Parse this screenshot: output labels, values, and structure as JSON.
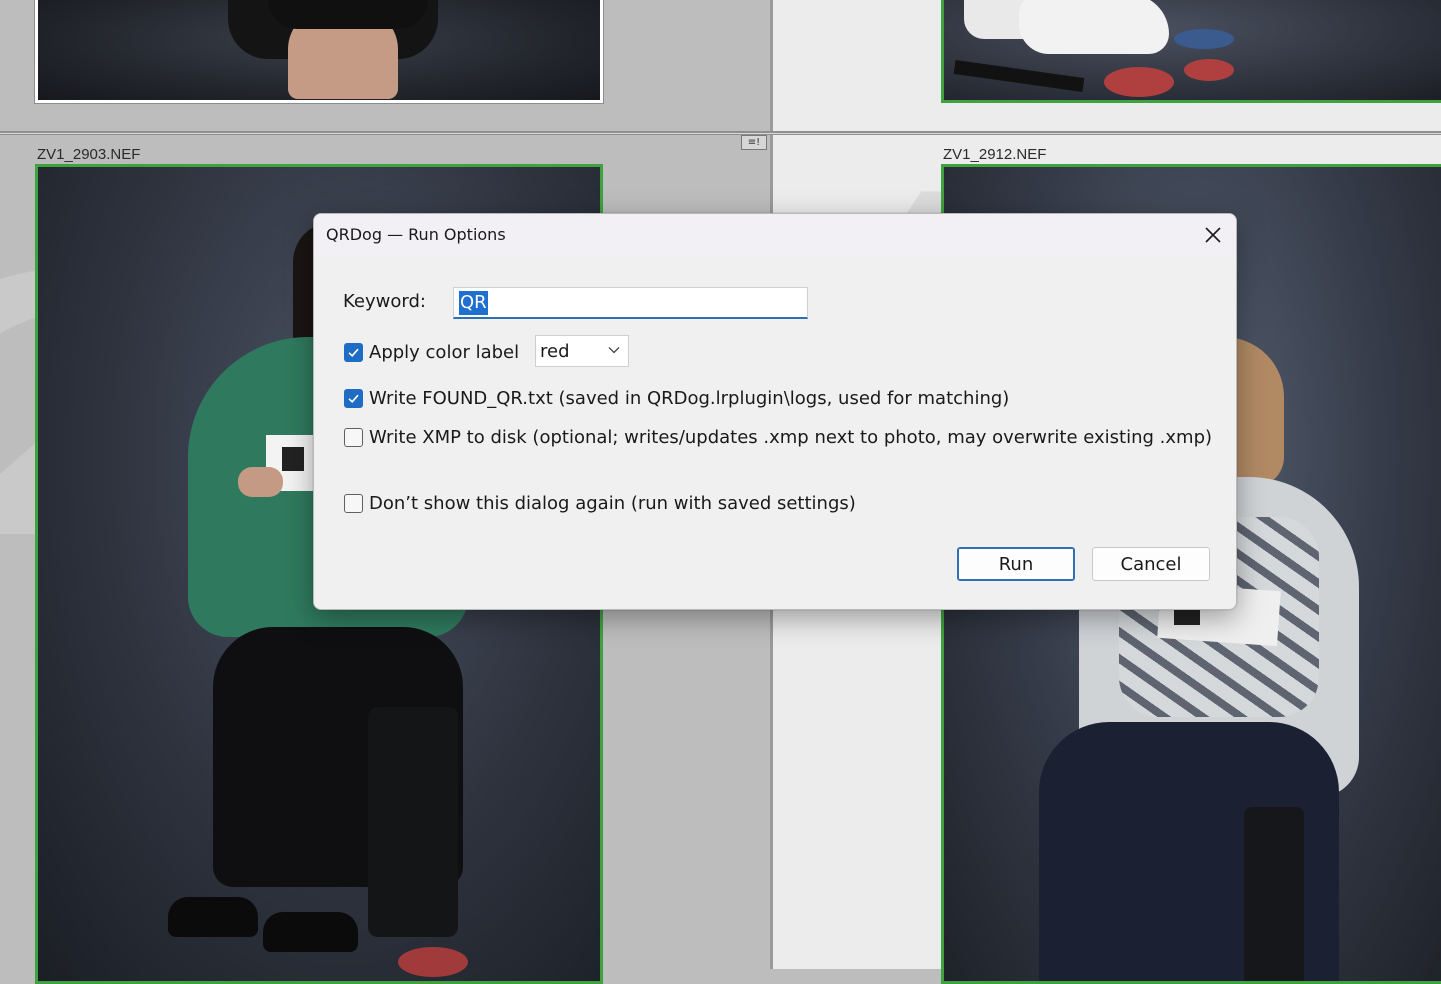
{
  "background": {
    "cells": [
      {
        "filename": "ZV1_2903.NEF"
      },
      {
        "filename": "ZV1_2912.NEF"
      }
    ],
    "badge_glyph": "≡!"
  },
  "dialog": {
    "title": "QRDog — Run Options",
    "keyword_label": "Keyword:",
    "keyword_value": "QR",
    "color_label_text": "Apply color label",
    "color_label_checked": true,
    "color_value": "red",
    "write_found_text": "Write FOUND_QR.txt (saved in QRDog.lrplugin\\logs, used for matching)",
    "write_found_checked": true,
    "write_xmp_text": "Write XMP to disk (optional; writes/updates .xmp next to photo, may overwrite existing .xmp)",
    "write_xmp_checked": false,
    "dont_show_text": "Don’t show this dialog again (run with saved settings)",
    "dont_show_checked": false,
    "run_label": "Run",
    "cancel_label": "Cancel"
  },
  "colors": {
    "accent": "#1f6cc4",
    "selection_border": "#3ea33e"
  }
}
